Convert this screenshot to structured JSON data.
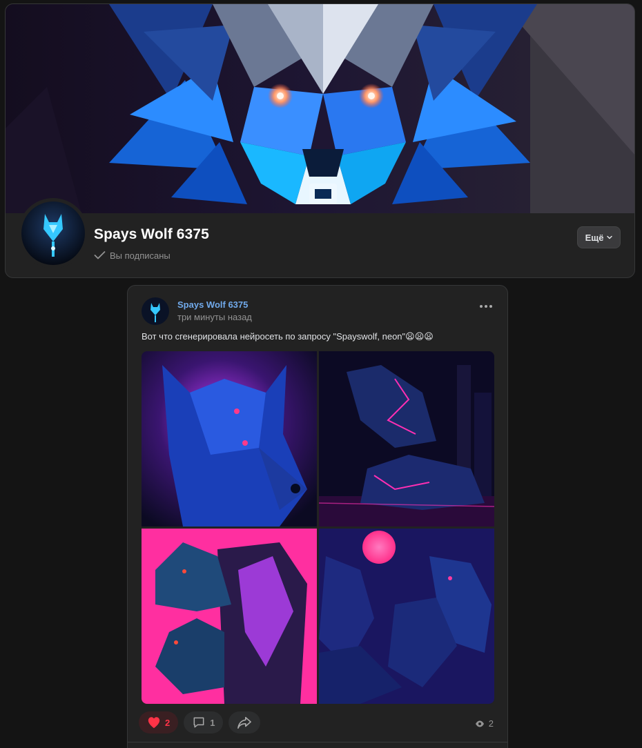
{
  "colors": {
    "background": "#141414",
    "card": "#222222",
    "accent_link": "#71aaeb",
    "like_red": "#ff3347",
    "muted": "#939393",
    "neon_blue": "#1fa8ff",
    "neon_pink": "#ff2fb3"
  },
  "group": {
    "name": "Spays Wolf 6375",
    "subscription_status": "Вы подписаны",
    "subscription_icon": "checkmark-icon",
    "more_label": "Ещё",
    "more_icon": "chevron-down-icon"
  },
  "post": {
    "author": "Spays Wolf 6375",
    "time": "три минуты назад",
    "menu_icon": "more-horizontal-icon",
    "text": "Вот что сгенерировала нейросеть по запросу \"Spayswolf, neon\"😦😦😦",
    "photos": [
      {
        "subject": "blue wolf head portrait on purple glow"
      },
      {
        "subject": "two neon wolves in dark city"
      },
      {
        "subject": "two blue wolves on pink background"
      },
      {
        "subject": "wolf pack howling under pink moon"
      }
    ],
    "likes_count": "2",
    "likes_icon": "heart-icon",
    "comments_count": "1",
    "comments_icon": "comment-icon",
    "share_icon": "share-icon",
    "views_count": "2",
    "views_icon": "eye-icon"
  }
}
